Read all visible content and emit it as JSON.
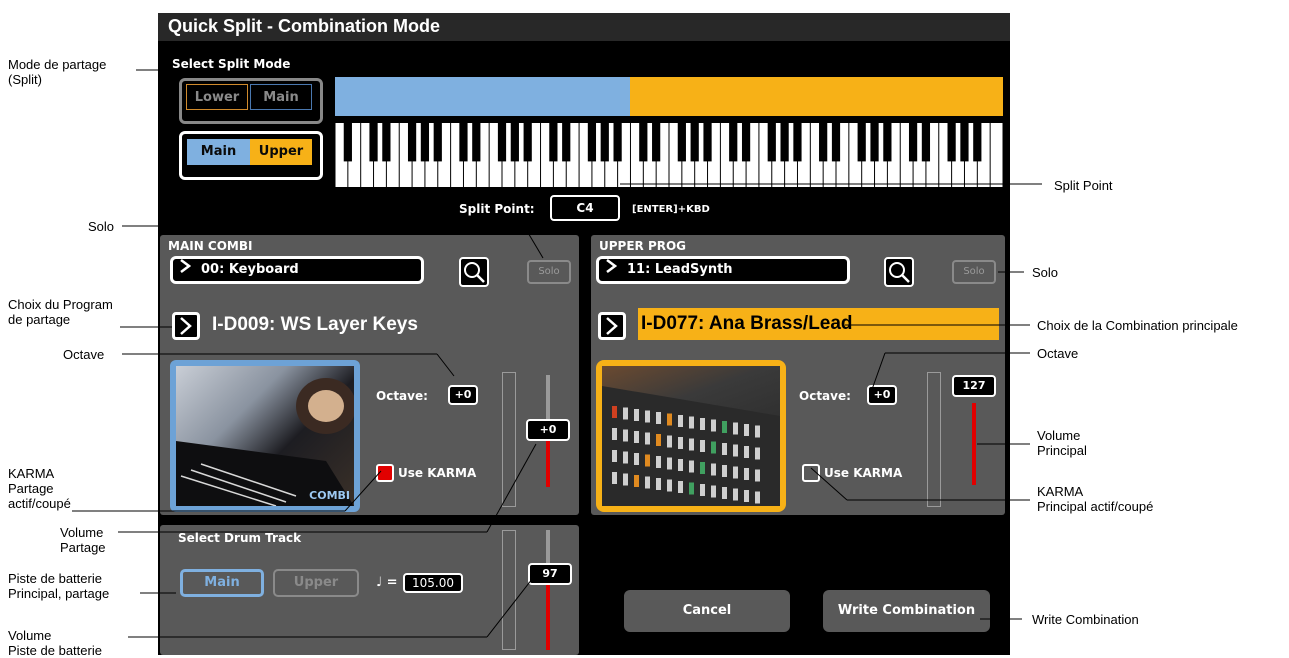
{
  "window": {
    "title": "Quick Split  - Combination Mode"
  },
  "split_mode": {
    "label": "Select Split Mode",
    "option_lower_main": {
      "lower": "Lower",
      "main": "Main"
    },
    "option_main_upper": {
      "main": "Main",
      "upper": "Upper",
      "selected": true
    }
  },
  "split_point": {
    "label": "Split Point:",
    "value": "C4",
    "hint": "[ENTER]+KBD"
  },
  "main_combi": {
    "title": "MAIN COMBI",
    "category": "00: Keyboard",
    "solo": "Solo",
    "program": "I-D009: WS Layer Keys",
    "octave_label": "Octave:",
    "octave": "+0",
    "karma_label": "Use KARMA",
    "karma_on": true,
    "volume": "+0",
    "image_tag": "COMBI"
  },
  "upper_prog": {
    "title": "UPPER PROG",
    "category": "11: LeadSynth",
    "solo": "Solo",
    "program": "I-D077: Ana Brass/Lead",
    "octave_label": "Octave:",
    "octave": "+0",
    "karma_label": "Use KARMA",
    "karma_on": false,
    "volume": "127"
  },
  "drum_track": {
    "title": "Select Drum Track",
    "main": "Main",
    "upper": "Upper",
    "tempo_symbol": "♩ =",
    "tempo": "105.00",
    "volume": "97"
  },
  "buttons": {
    "cancel": "Cancel",
    "write": "Write Combination"
  },
  "annotations": {
    "mode_partage": "Mode de partage\n(Split)",
    "solo_left": "Solo",
    "choix_program": "Choix du Program\nde partage",
    "octave_left": "Octave",
    "karma_left": "KARMA\nPartage\nactif/coupé",
    "volume_partage": "Volume\nPartage",
    "piste_batterie": "Piste de batterie\nPrincipal, partage",
    "volume_piste": "Volume\nPiste de batterie",
    "split_point": "Split Point",
    "solo_right": "Solo",
    "choix_combination": "Choix de la Combination principale",
    "octave_right": "Octave",
    "volume_principal": "Volume\nPrincipal",
    "karma_right": "KARMA\nPrincipal actif/coupé",
    "write_combination": "Write Combination"
  },
  "colors": {
    "lower_blue": "#7fb0e0",
    "upper_orange": "#f7b117",
    "volume_red": "#e10000"
  }
}
